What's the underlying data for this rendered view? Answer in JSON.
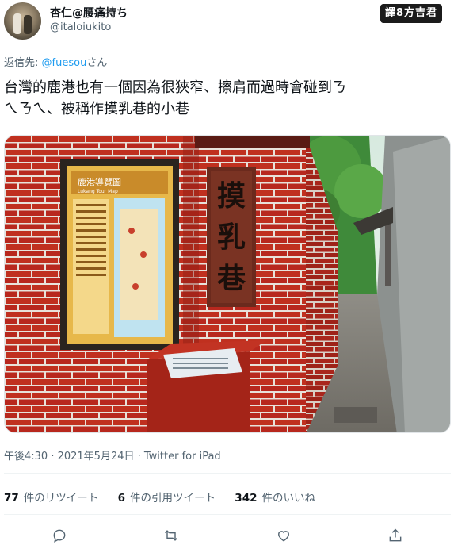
{
  "tweet": {
    "display_name": "杏仁@腰痛持ち",
    "handle": "@italoiukito",
    "watermark": "譯8方吉君",
    "reply_prefix": "返信先:",
    "reply_mention": "@fuesou",
    "reply_suffix": "さん",
    "text_line1": "台灣的鹿港也有一個因為很狹窄、擦肩而過時會碰到ㄋ",
    "text_line2": "ㄟㄋㄟ、被稱作摸乳巷的小巷",
    "timestamp": "午後4:30 · 2021年5月24日 · Twitter for iPad"
  },
  "photo": {
    "sign_chars": [
      "摸",
      "乳",
      "巷"
    ],
    "map_title": "鹿港導覽圖",
    "map_subtitle": "Lukang Tour Map"
  },
  "stats": {
    "retweets_count": "77",
    "retweets_label": "件のリツイート",
    "quotes_count": "6",
    "quotes_label": "件の引用ツイート",
    "likes_count": "342",
    "likes_label": "件のいいね"
  },
  "icons": {
    "reply": "reply-icon",
    "retweet": "retweet-icon",
    "like": "heart-icon",
    "share": "share-icon"
  },
  "colors": {
    "link": "#1d9bf0",
    "secondary_text": "#536471",
    "brick": "#b8281e"
  }
}
